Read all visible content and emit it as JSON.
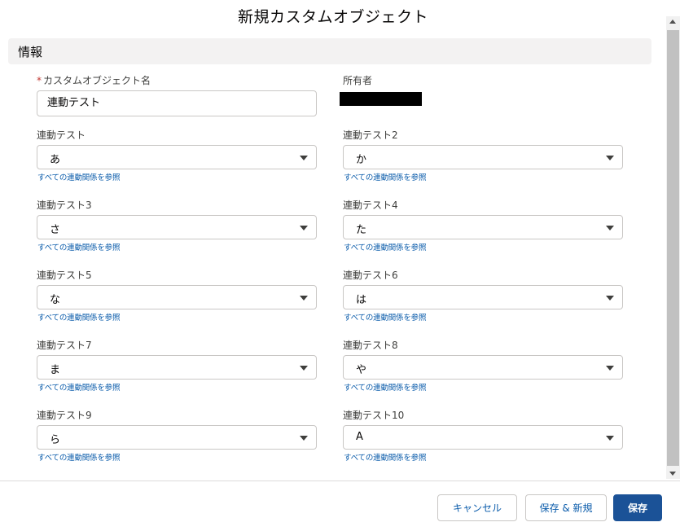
{
  "modal": {
    "title": "新規カスタムオブジェクト"
  },
  "section": {
    "title": "情報"
  },
  "name_field": {
    "required_mark": "*",
    "label": "カスタムオブジェクト名",
    "value": "連動テスト"
  },
  "owner_field": {
    "label": "所有者"
  },
  "dependency_link": "すべての連動関係を参照",
  "picklists": [
    {
      "label": "連動テスト",
      "value": "あ"
    },
    {
      "label": "連動テスト2",
      "value": "か"
    },
    {
      "label": "連動テスト3",
      "value": "さ"
    },
    {
      "label": "連動テスト4",
      "value": "た"
    },
    {
      "label": "連動テスト5",
      "value": "な"
    },
    {
      "label": "連動テスト6",
      "value": "は"
    },
    {
      "label": "連動テスト7",
      "value": "ま"
    },
    {
      "label": "連動テスト8",
      "value": "や"
    },
    {
      "label": "連動テスト9",
      "value": "ら"
    },
    {
      "label": "連動テスト10",
      "value": "A"
    }
  ],
  "footer": {
    "cancel_label": "キャンセル",
    "save_new_label": "保存 & 新規",
    "save_label": "保存"
  }
}
